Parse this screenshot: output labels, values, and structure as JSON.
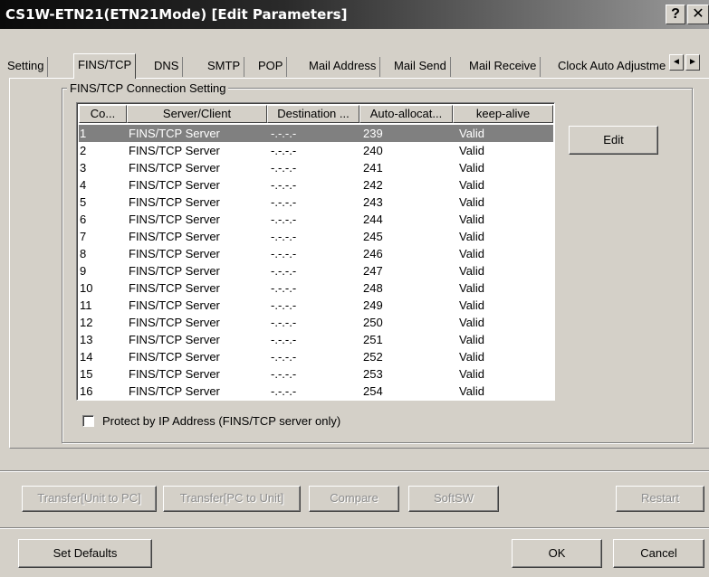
{
  "window": {
    "title": "CS1W-ETN21(ETN21Mode) [Edit Parameters]",
    "help_glyph": "?",
    "close_glyph": "✕"
  },
  "tabs": [
    {
      "label": "Setting"
    },
    {
      "label": "FINS/TCP",
      "active": true
    },
    {
      "label": "DNS"
    },
    {
      "label": "SMTP"
    },
    {
      "label": "POP"
    },
    {
      "label": "Mail Address"
    },
    {
      "label": "Mail Send"
    },
    {
      "label": "Mail Receive"
    },
    {
      "label": "Clock Auto Adjustme"
    }
  ],
  "tab_scroll": {
    "left": "◄",
    "right": "►"
  },
  "group": {
    "label": "FINS/TCP Connection Setting",
    "columns": [
      "Co...",
      "Server/Client",
      "Destination ...",
      "Auto-allocat...",
      "keep-alive"
    ],
    "rows": [
      {
        "no": "1",
        "server": "FINS/TCP Server",
        "dest": "-.-.-.-",
        "auto": "239",
        "keep": "Valid",
        "selected": true
      },
      {
        "no": "2",
        "server": "FINS/TCP Server",
        "dest": "-.-.-.-",
        "auto": "240",
        "keep": "Valid"
      },
      {
        "no": "3",
        "server": "FINS/TCP Server",
        "dest": "-.-.-.-",
        "auto": "241",
        "keep": "Valid"
      },
      {
        "no": "4",
        "server": "FINS/TCP Server",
        "dest": "-.-.-.-",
        "auto": "242",
        "keep": "Valid"
      },
      {
        "no": "5",
        "server": "FINS/TCP Server",
        "dest": "-.-.-.-",
        "auto": "243",
        "keep": "Valid"
      },
      {
        "no": "6",
        "server": "FINS/TCP Server",
        "dest": "-.-.-.-",
        "auto": "244",
        "keep": "Valid"
      },
      {
        "no": "7",
        "server": "FINS/TCP Server",
        "dest": "-.-.-.-",
        "auto": "245",
        "keep": "Valid"
      },
      {
        "no": "8",
        "server": "FINS/TCP Server",
        "dest": "-.-.-.-",
        "auto": "246",
        "keep": "Valid"
      },
      {
        "no": "9",
        "server": "FINS/TCP Server",
        "dest": "-.-.-.-",
        "auto": "247",
        "keep": "Valid"
      },
      {
        "no": "10",
        "server": "FINS/TCP Server",
        "dest": "-.-.-.-",
        "auto": "248",
        "keep": "Valid"
      },
      {
        "no": "11",
        "server": "FINS/TCP Server",
        "dest": "-.-.-.-",
        "auto": "249",
        "keep": "Valid"
      },
      {
        "no": "12",
        "server": "FINS/TCP Server",
        "dest": "-.-.-.-",
        "auto": "250",
        "keep": "Valid"
      },
      {
        "no": "13",
        "server": "FINS/TCP Server",
        "dest": "-.-.-.-",
        "auto": "251",
        "keep": "Valid"
      },
      {
        "no": "14",
        "server": "FINS/TCP Server",
        "dest": "-.-.-.-",
        "auto": "252",
        "keep": "Valid"
      },
      {
        "no": "15",
        "server": "FINS/TCP Server",
        "dest": "-.-.-.-",
        "auto": "253",
        "keep": "Valid"
      },
      {
        "no": "16",
        "server": "FINS/TCP Server",
        "dest": "-.-.-.-",
        "auto": "254",
        "keep": "Valid"
      }
    ],
    "edit_button": "Edit",
    "protect_checkbox": {
      "label": "Protect by IP Address (FINS/TCP server only)",
      "checked": false
    }
  },
  "actions": {
    "transfer_unit_to_pc": "Transfer[Unit to PC]",
    "transfer_pc_to_unit": "Transfer[PC to Unit]",
    "compare": "Compare",
    "softsw": "SoftSW",
    "restart": "Restart"
  },
  "footer": {
    "set_defaults": "Set Defaults",
    "ok": "OK",
    "cancel": "Cancel"
  },
  "colors": {
    "face": "#d4d0c8",
    "selected_row": "#808080",
    "disabled_text": "#8c8c8c"
  }
}
